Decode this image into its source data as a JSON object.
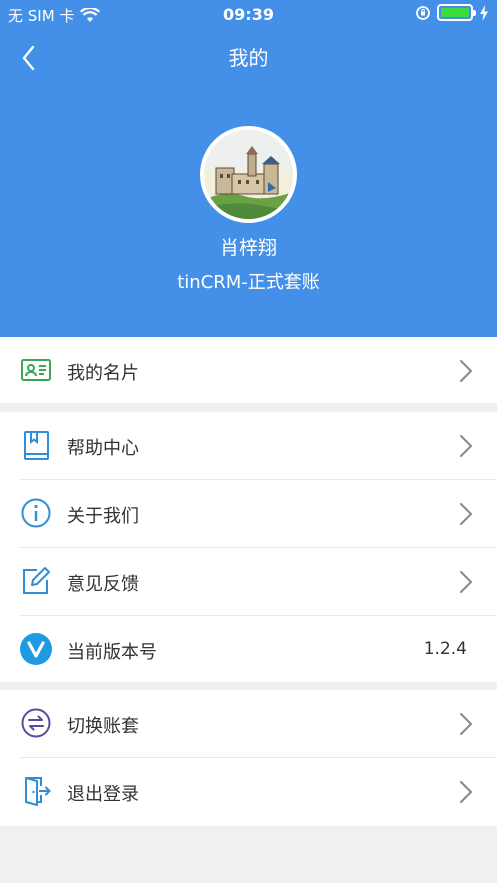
{
  "status_bar": {
    "carrier": "无 SIM 卡",
    "time": "09:39"
  },
  "nav": {
    "title": "我的"
  },
  "profile": {
    "name": "肖梓翔",
    "account": "tinCRM-正式套账"
  },
  "menu": {
    "business_card": "我的名片",
    "help_center": "帮助中心",
    "about_us": "关于我们",
    "feedback": "意见反馈",
    "version_label": "当前版本号",
    "version_value": "1.2.4",
    "switch_account": "切换账套",
    "logout": "退出登录"
  },
  "colors": {
    "header_bg": "#4490e8",
    "green_icon": "#3aa757",
    "blue_icon": "#2e8fd6",
    "purple_icon": "#5b4a9e"
  }
}
